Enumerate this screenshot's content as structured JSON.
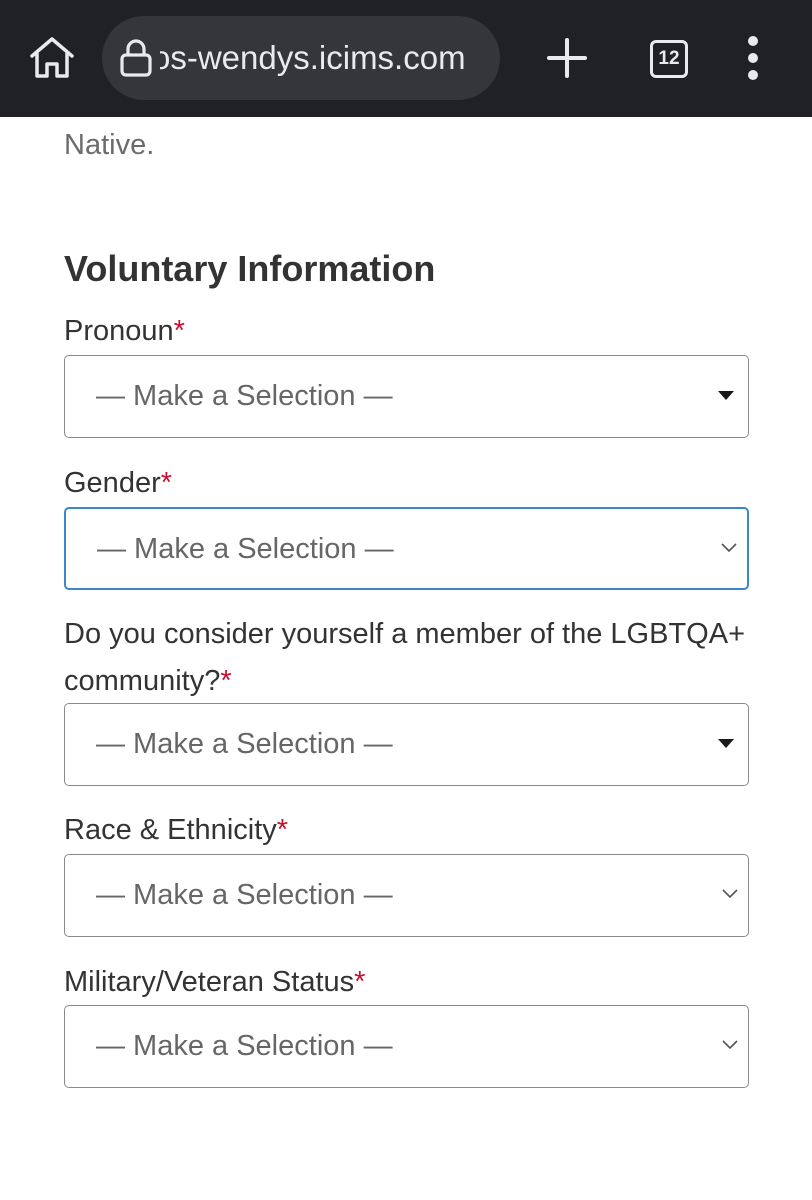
{
  "browser": {
    "url": "os-wendys.icims.com",
    "tab_count": "12",
    "icons": {
      "home": "home-icon",
      "lock": "lock-icon",
      "new_tab": "plus-icon",
      "tabs": "tab-switcher-icon",
      "menu": "more-vert-icon"
    }
  },
  "page": {
    "prev_text_tail": "Native.",
    "section_heading": "Voluntary Information",
    "fields": [
      {
        "label": "Pronoun",
        "required_marker": "*",
        "value": "— Make a Selection —",
        "arrow": "caret-down-icon"
      },
      {
        "label": "Gender",
        "required_marker": "*",
        "value": "— Make a Selection —",
        "arrow": "chevron-down-icon",
        "focused": true
      },
      {
        "label_line1": "Do you consider yourself a member of the LGBTQA+",
        "label_line2": "community?",
        "required_marker": "*",
        "value": "— Make a Selection —",
        "arrow": "caret-down-icon"
      },
      {
        "label": "Race & Ethnicity",
        "required_marker": "*",
        "value": "— Make a Selection —",
        "arrow": "chevron-down-icon"
      },
      {
        "label": "Military/Veteran Status",
        "required_marker": "*",
        "value": "— Make a Selection —",
        "arrow": "chevron-down-icon"
      }
    ]
  },
  "colors": {
    "browser_bar": "#202124",
    "omnibox": "#35363a",
    "required": "#c8102e",
    "focus_border": "#3b87c8",
    "text": "#333333",
    "placeholder": "#666666"
  }
}
